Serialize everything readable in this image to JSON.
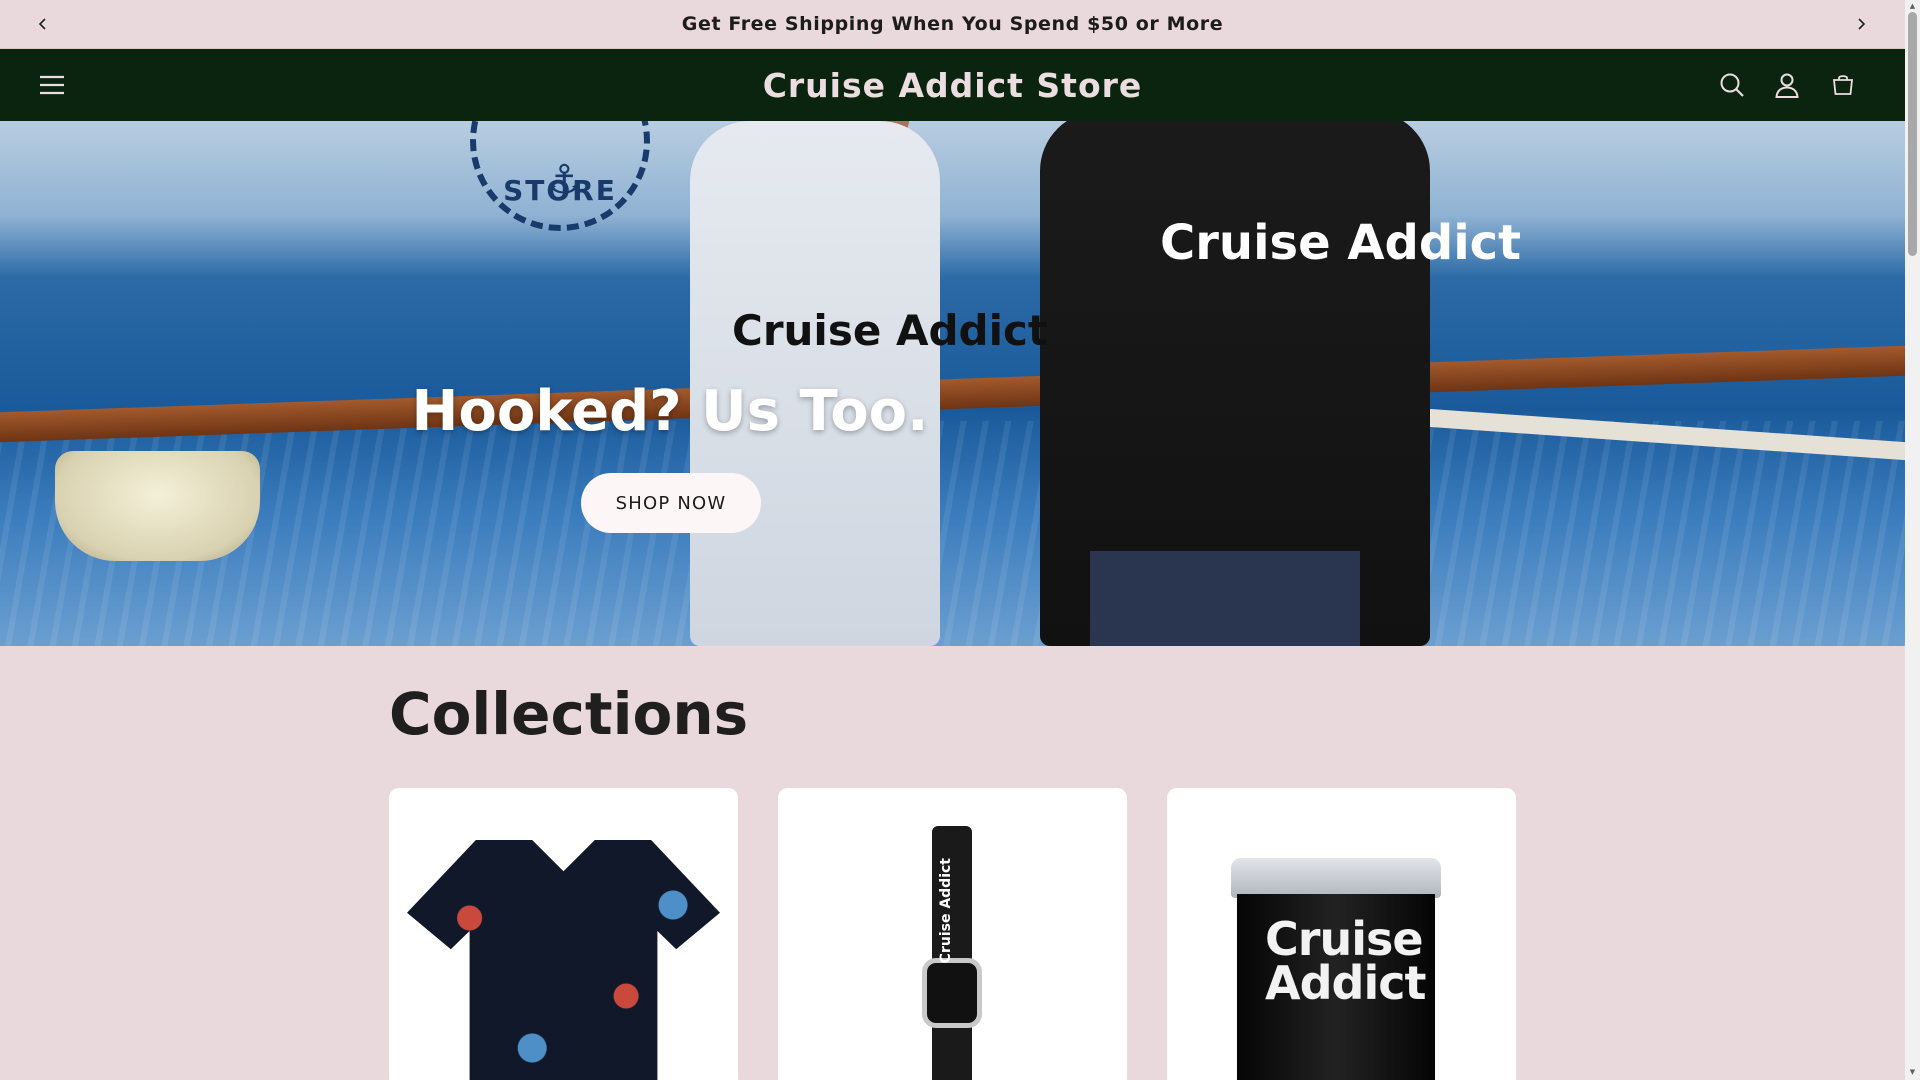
{
  "announcement": {
    "text": "Get Free Shipping When You Spend $50 or More",
    "prev_icon": "chevron-left-icon",
    "next_icon": "chevron-right-icon"
  },
  "header": {
    "brand": "Cruise Addict Store",
    "menu_icon": "hamburger-icon",
    "icons": [
      "search-icon",
      "account-icon",
      "cart-icon"
    ],
    "background": "#0a2410"
  },
  "hero": {
    "title": "Hooked? Us Too.",
    "cta_label": "SHOP NOW",
    "logo_text": "STORE",
    "white_shirt_text": "Cruise Addict",
    "black_shirt_text": "Cruise Addict"
  },
  "collections": {
    "title": "Collections",
    "cards": [
      {
        "image": "hawaiian-shirt"
      },
      {
        "image": "watch-band",
        "print": "Cruise Addict"
      },
      {
        "image": "tumbler",
        "print": "Cruise Addict"
      }
    ]
  },
  "colors": {
    "page_bg": "#ead9dc",
    "header_bg": "#0a2410",
    "brand_text": "#ecdde0",
    "button_bg": "#fcf6f7"
  }
}
